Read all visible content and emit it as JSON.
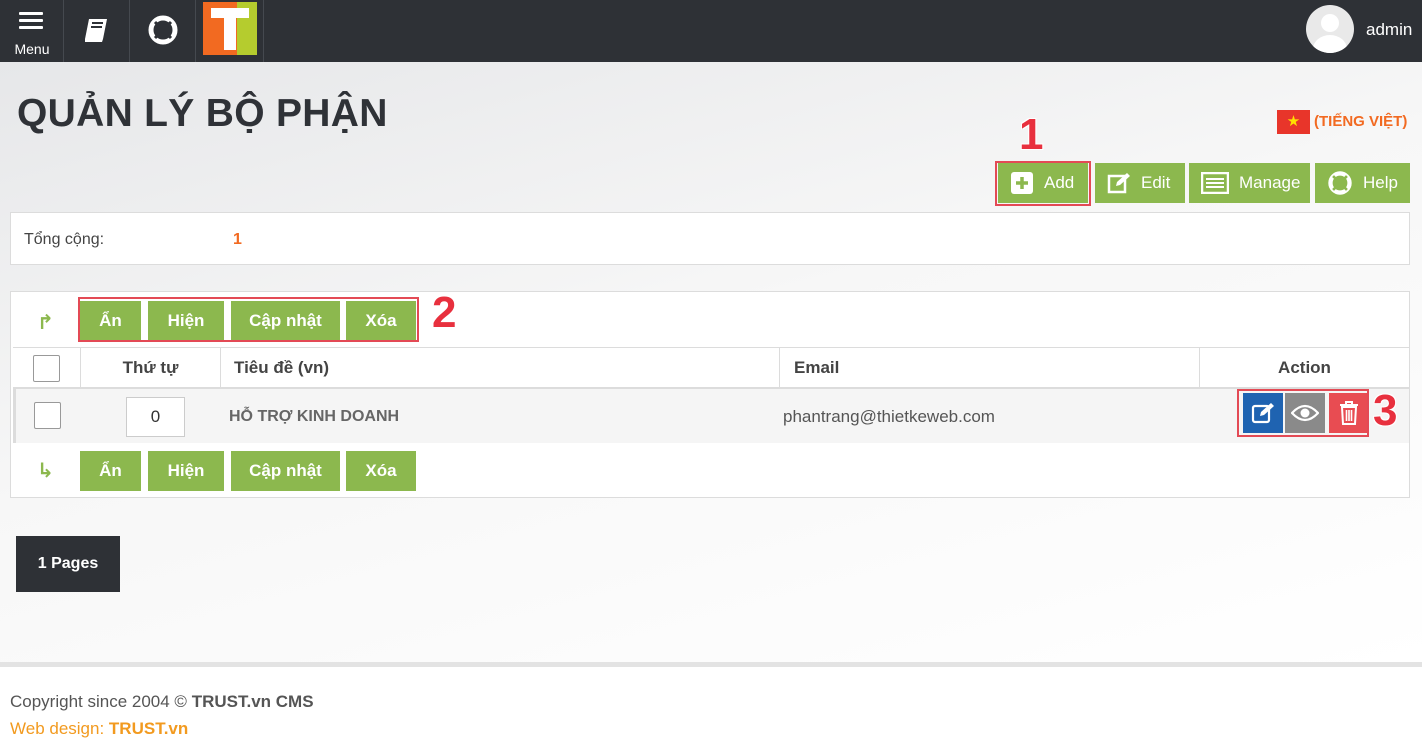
{
  "topbar": {
    "menu_label": "Menu",
    "user_name": "admin",
    "icons": [
      "menu-icon",
      "book-icon",
      "lifebuoy-icon",
      "logo",
      "user-avatar"
    ]
  },
  "page": {
    "title": "QUẢN LÝ BỘ PHẬN",
    "language": "(TIẾNG VIỆT)"
  },
  "toolbar": {
    "add": "Add",
    "edit": "Edit",
    "manage": "Manage",
    "help": "Help"
  },
  "summary": {
    "label": "Tổng cộng:",
    "value": "1"
  },
  "bulk_actions": {
    "hide": "Ẩn",
    "show": "Hiện",
    "update": "Cập nhật",
    "delete": "Xóa"
  },
  "table": {
    "columns": [
      "Thứ tự",
      "Tiêu đề (vn)",
      "Email",
      "Action"
    ],
    "rows": [
      {
        "order": "0",
        "title": "HỖ TRỢ KINH DOANH",
        "email": "phantrang@thietkeweb.com"
      }
    ]
  },
  "annotations": [
    "1",
    "2",
    "3"
  ],
  "pagination": {
    "label": "1 Pages"
  },
  "footer": {
    "copyright_prefix": "Copyright since 2004 © ",
    "copyright_brand": "TRUST.vn CMS",
    "design_prefix": "Web design: ",
    "design_brand": "TRUST.vn"
  },
  "colors": {
    "topbar": "#2e3136",
    "green": "#8cb84e",
    "orange": "#f26a21",
    "annotation": "#e34a55",
    "edit_blue": "#1f63b1",
    "view_gray": "#8a8a8a",
    "delete_red": "#e84c52"
  }
}
